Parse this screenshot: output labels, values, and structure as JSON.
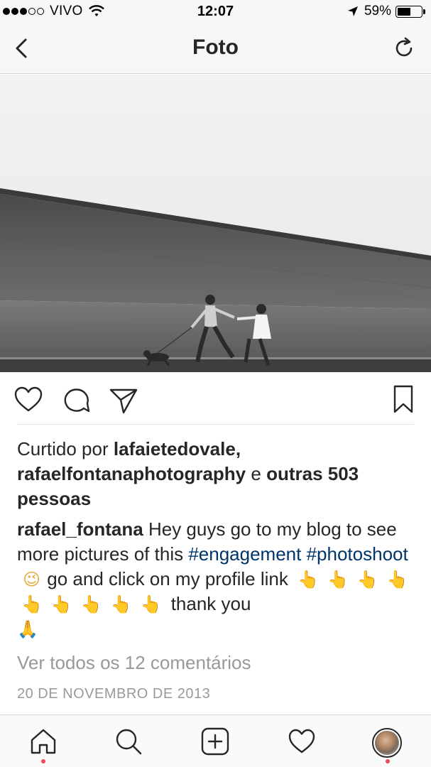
{
  "status_bar": {
    "carrier": "VIVO",
    "time": "12:07",
    "battery_percent": "59%",
    "battery_level": 0.59,
    "signal_bars_filled": 3,
    "signal_bars_total": 5
  },
  "nav": {
    "title": "Foto",
    "back_icon": "chevron-left-icon",
    "refresh_icon": "refresh-icon"
  },
  "post": {
    "likes": {
      "prefix": "Curtido por",
      "user1": "lafaietedovale,",
      "user2": "rafaelfontanaphotography",
      "conjunction": "e",
      "others": "outras 503 pessoas"
    },
    "caption": {
      "author": "rafael_fontana",
      "text1": "Hey guys go to my blog to see more pictures of this",
      "hashtag1": "#engagement",
      "hashtag2": "#photoshoot",
      "text2": "go and click on my profile link",
      "text3": "thank you",
      "emoji_wink": "😉",
      "emoji_point": "👆",
      "emoji_pray": "🙏"
    },
    "view_comments": "Ver todos os 12 comentários",
    "date": "20 DE NOVEMBRO DE 2013"
  },
  "actions": [
    "heart-icon",
    "comment-icon",
    "share-icon",
    "bookmark-icon"
  ],
  "tab_bar": {
    "items": [
      "home-icon",
      "search-icon",
      "add-icon",
      "heart-icon",
      "profile-avatar"
    ]
  },
  "colors": {
    "text": "#262626",
    "hashtag": "#003569",
    "muted": "#999999",
    "notification": "#ed4956"
  }
}
